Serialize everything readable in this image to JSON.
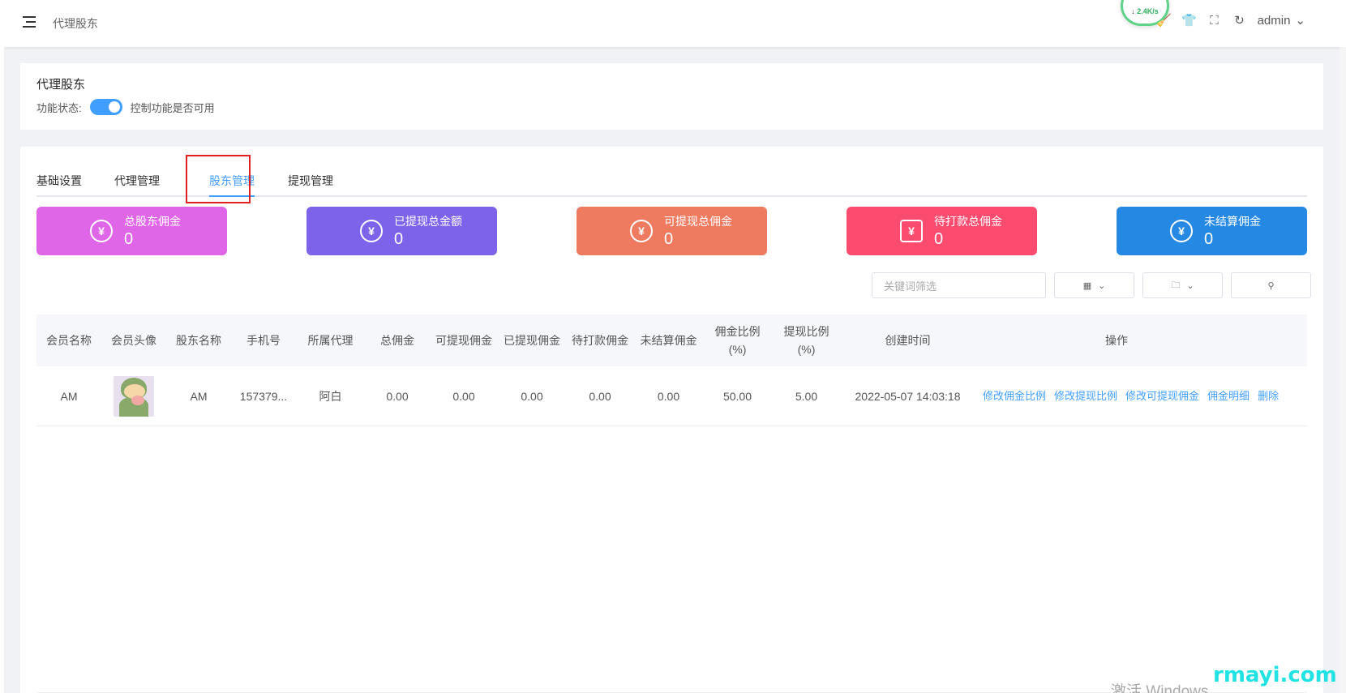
{
  "header": {
    "breadcrumb": "代理股东",
    "net_speed": "2.4K/s",
    "user": "admin"
  },
  "module": {
    "title": "代理股东",
    "status_label": "功能状态:",
    "status_desc": "控制功能是否可用",
    "enabled": true
  },
  "tabs": [
    {
      "label": "基础设置"
    },
    {
      "label": "代理管理"
    },
    {
      "label": "股东管理"
    },
    {
      "label": "提现管理"
    }
  ],
  "active_tab": "股东管理",
  "stats": [
    {
      "label": "总股东佣金",
      "value": "0",
      "color": "#e066e8"
    },
    {
      "label": "已提现总金额",
      "value": "0",
      "color": "#7d62ea"
    },
    {
      "label": "可提现总佣金",
      "value": "0",
      "color": "#ee7a60"
    },
    {
      "label": "待打款总佣金",
      "value": "0",
      "color": "#fb4b6e"
    },
    {
      "label": "未结算佣金",
      "value": "0",
      "color": "#2589e4"
    }
  ],
  "filters": {
    "keyword_placeholder": "关键词筛选"
  },
  "table": {
    "columns": [
      "会员名称",
      "会员头像",
      "股东名称",
      "手机号",
      "所属代理",
      "总佣金",
      "可提现佣金",
      "已提现佣金",
      "待打款佣金",
      "未结算佣金",
      "佣金比例(%)",
      "提现比例(%)",
      "创建时间",
      "操作"
    ],
    "rows": [
      {
        "member_name": "AM",
        "shareholder_name": "AM",
        "phone": "157379...",
        "agent": "阿白",
        "total": "0.00",
        "withdrawable": "0.00",
        "withdrawn": "0.00",
        "pending": "0.00",
        "unsettled": "0.00",
        "commission_ratio": "50.00",
        "withdraw_ratio": "5.00",
        "created_at": "2022-05-07 14:03:18",
        "actions": [
          "修改佣金比例",
          "修改提现比例",
          "修改可提现佣金",
          "佣金明细",
          "删除"
        ]
      }
    ]
  },
  "footer": {
    "watermark": "激活 Windows",
    "brand": "rmayi.com"
  }
}
